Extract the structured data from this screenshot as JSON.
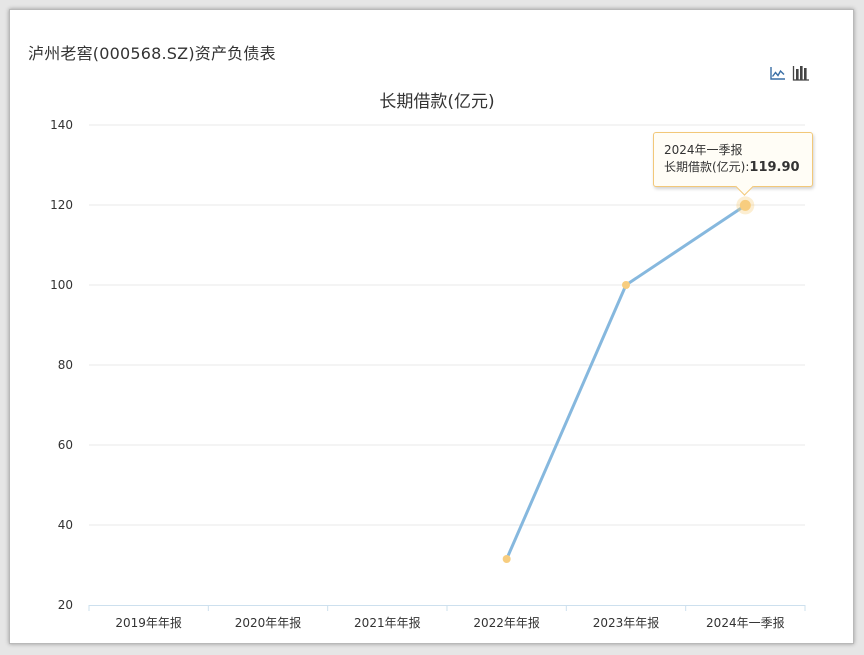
{
  "page": {
    "title_text": "泸州老窖(000568.SZ)资产负债表"
  },
  "toolbar": {
    "line_icon": "line-chart-icon",
    "bar_icon": "bar-chart-icon"
  },
  "tooltip": {
    "period": "2024年一季报",
    "label": "长期借款(亿元):",
    "value": "119.90"
  },
  "colors": {
    "line": "#86b8de",
    "point": "#f7cd7f",
    "grid": "#e8e8e8",
    "axis": "#cde0ee"
  },
  "chart_data": {
    "type": "line",
    "title": "长期借款(亿元)",
    "categories": [
      "2019年年报",
      "2020年年报",
      "2021年年报",
      "2022年年报",
      "2023年年报",
      "2024年一季报"
    ],
    "series": [
      {
        "values": [
          null,
          null,
          null,
          31.5,
          100.0,
          119.9
        ]
      }
    ],
    "ylim": [
      20,
      140
    ],
    "yticks": [
      20,
      40,
      60,
      80,
      100,
      120,
      140
    ],
    "highlight_index": 5,
    "grid": true,
    "legend": "none"
  }
}
